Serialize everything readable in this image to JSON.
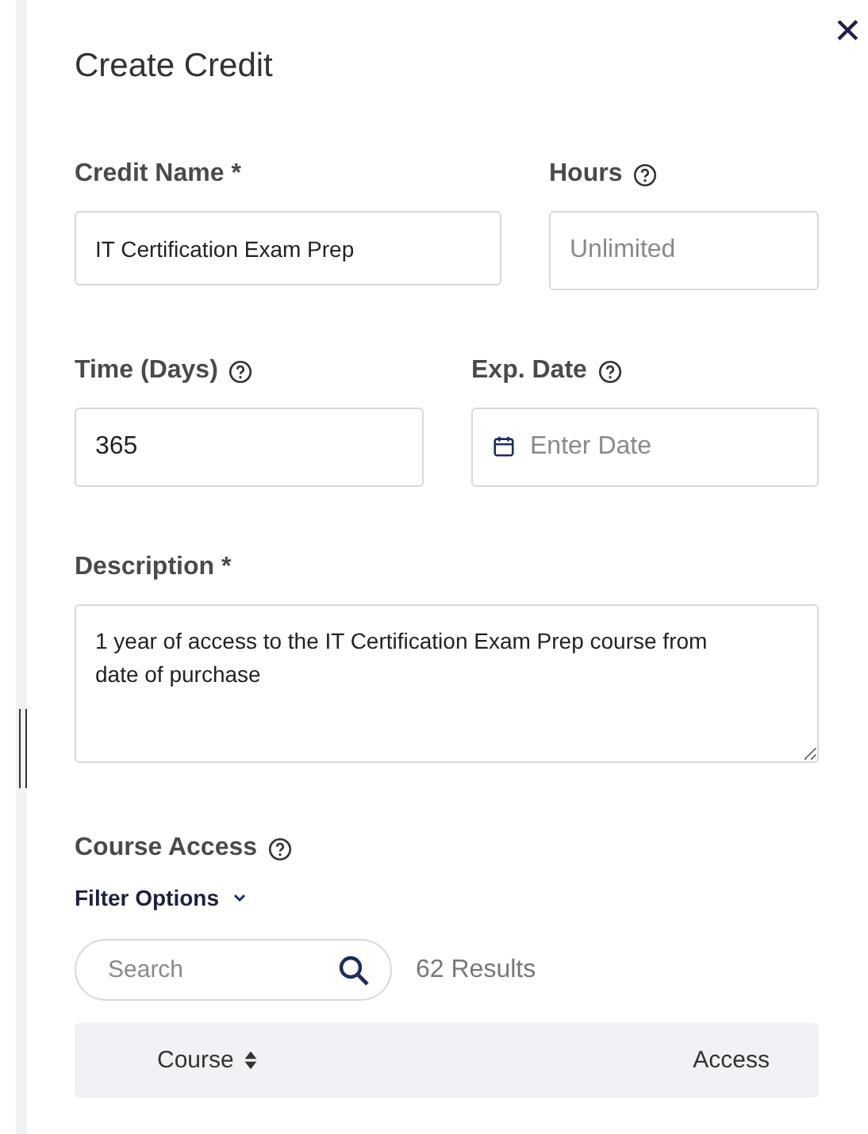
{
  "title": "Create Credit",
  "close": "✕",
  "field_rows": [
    [
      {
        "kind": "text",
        "label": "Credit Name *",
        "help": false,
        "value": "IT Certification Exam Prep"
      },
      {
        "kind": "text",
        "label": "Hours",
        "help": true,
        "placeholder": "Unlimited"
      }
    ],
    [
      {
        "kind": "text",
        "label": "Time (Days)",
        "help": true,
        "value": "365"
      },
      {
        "kind": "date",
        "label": "Exp. Date",
        "help": true,
        "placeholder": "Enter Date"
      }
    ],
    [
      {
        "kind": "textarea",
        "label": "Description *",
        "help": false,
        "value": "1 year of access to the IT Certification Exam Prep course from date of purchase"
      }
    ]
  ],
  "course_access": {
    "label": "Course Access",
    "help": true,
    "filter": "Filter Options",
    "search": {
      "placeholder": "Search"
    },
    "results": "62 Results",
    "columns": [
      "Course",
      "Access"
    ]
  }
}
